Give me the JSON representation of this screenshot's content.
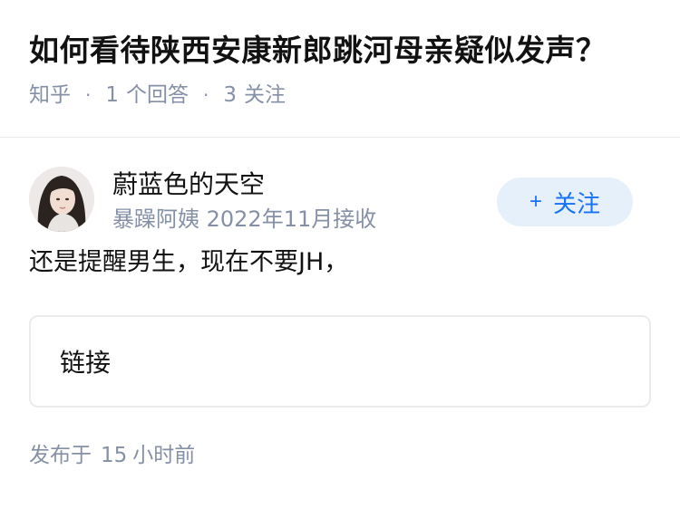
{
  "question": {
    "title": "如何看待陕西安康新郎跳河母亲疑似发声？",
    "source": "知乎",
    "answer_count": "1",
    "answer_label": "个回答",
    "follow_count": "3",
    "follow_label": "关注"
  },
  "answer": {
    "author_name": "蔚蓝色的天空",
    "author_bio": "暴躁阿姨 2022年11月接收",
    "follow_button": "关注",
    "follow_plus": "+",
    "content": "还是提醒男生，现在不要JH，",
    "link_card_label": "链接",
    "publish_prefix": "发布于",
    "publish_num": "15",
    "publish_suffix": "小时前"
  },
  "colors": {
    "accent": "#1772f6",
    "follow_bg": "#e6f0fa",
    "meta_gray": "#8590a6"
  }
}
